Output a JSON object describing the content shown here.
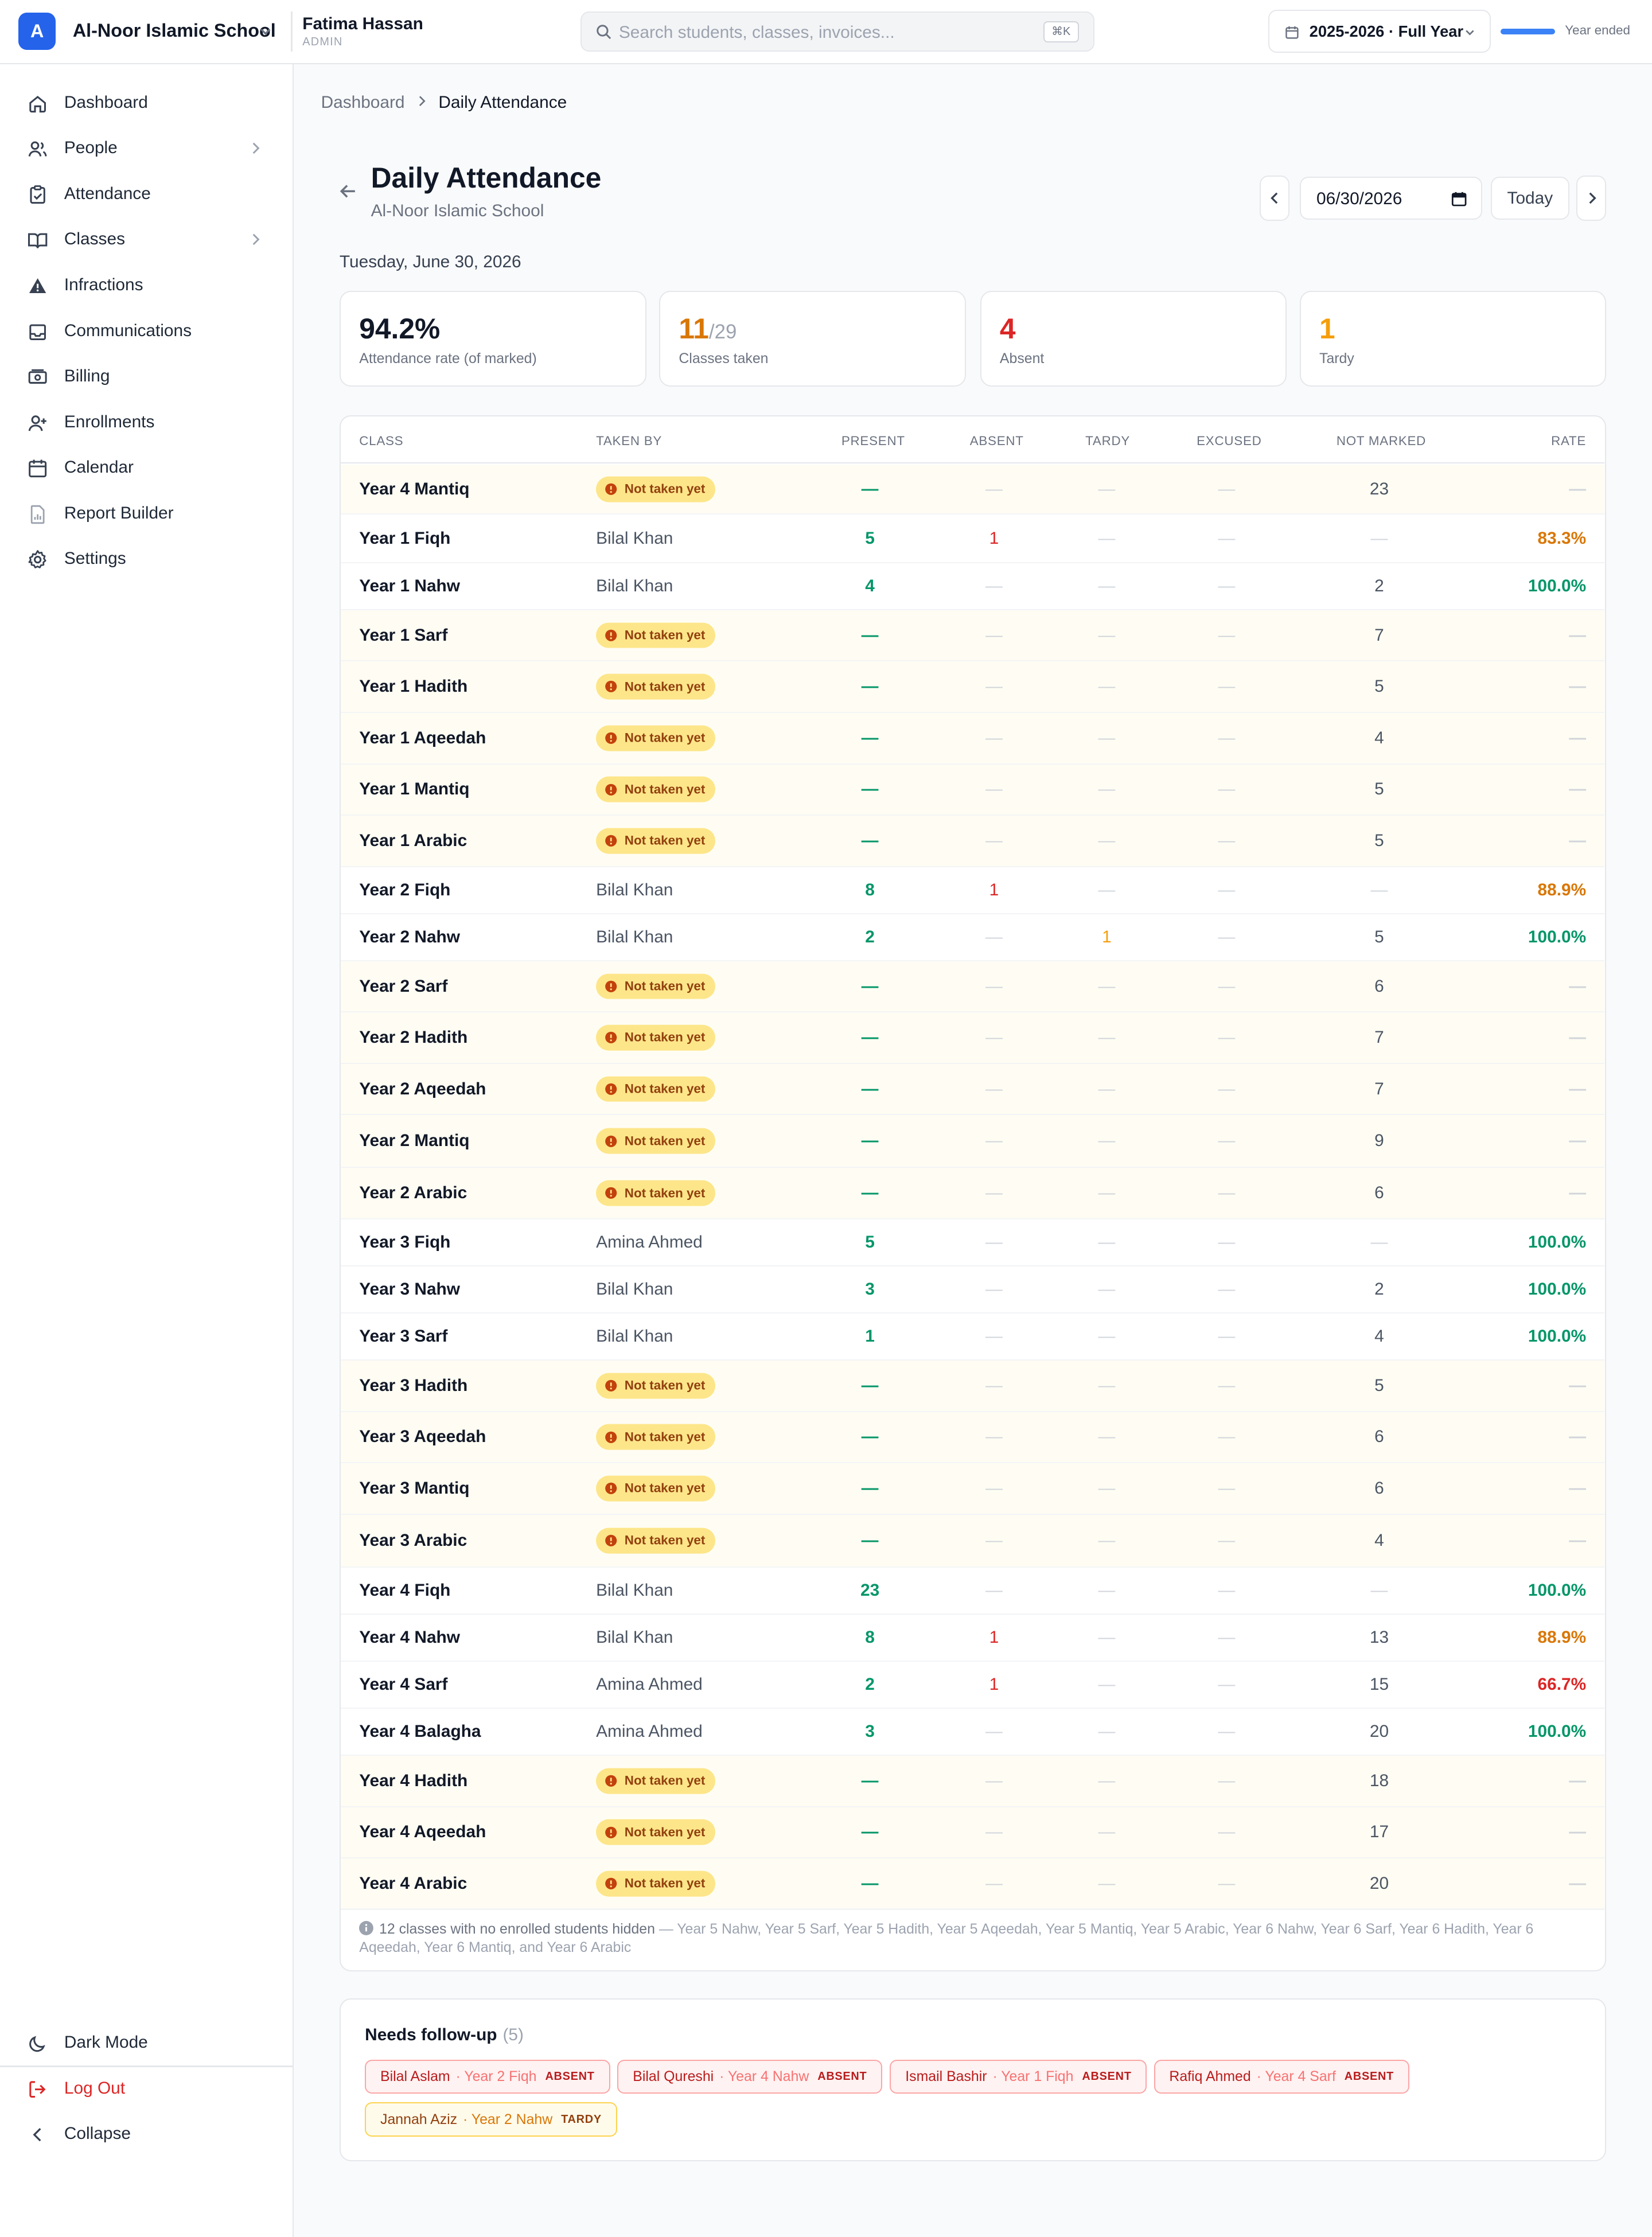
{
  "app": {
    "logo_letter": "A",
    "school_name": "Al-Noor Islamic School",
    "user_name": "Fatima Hassan",
    "user_role": "ADMIN",
    "search_placeholder": "Search students, classes, invoices...",
    "search_shortcut": "⌘K",
    "year_label": "2025-2026 · Full Year",
    "year_status": "Year ended",
    "year_progress": 1.0,
    "accent_color": "#2563eb"
  },
  "sidebar": {
    "items": [
      {
        "label": "Dashboard",
        "icon": "home-icon"
      },
      {
        "label": "People",
        "icon": "users-icon",
        "has_children": true
      },
      {
        "label": "Attendance",
        "icon": "clipboard-check-icon"
      },
      {
        "label": "Classes",
        "icon": "book-open-icon",
        "has_children": true
      },
      {
        "label": "Infractions",
        "icon": "alert-triangle-icon"
      },
      {
        "label": "Communications",
        "icon": "inbox-icon"
      },
      {
        "label": "Billing",
        "icon": "banknote-icon"
      },
      {
        "label": "Enrollments",
        "icon": "user-plus-icon"
      },
      {
        "label": "Calendar",
        "icon": "calendar-icon"
      },
      {
        "label": "Report Builder",
        "icon": "file-chart-icon"
      },
      {
        "label": "Settings",
        "icon": "gear-icon"
      }
    ],
    "bottom": {
      "dark_mode": "Dark Mode",
      "logout": "Log Out",
      "collapse": "Collapse"
    }
  },
  "breadcrumb": {
    "parent": "Dashboard",
    "current": "Daily Attendance"
  },
  "page": {
    "title": "Daily Attendance",
    "subtitle": "Al-Noor Islamic School",
    "date_value": "06/30/2026",
    "today_label": "Today",
    "long_date": "Tuesday, June 30, 2026"
  },
  "stats": {
    "rate": {
      "value": "94.2%",
      "label": "Attendance rate (of marked)",
      "color": "#111827"
    },
    "classes": {
      "value": "11",
      "denominator": "/29",
      "label": "Classes taken",
      "color": "#d97706"
    },
    "absent": {
      "value": "4",
      "label": "Absent",
      "color": "#dc2626"
    },
    "tardy": {
      "value": "1",
      "label": "Tardy",
      "color": "#f59e0b"
    }
  },
  "table": {
    "headers": {
      "class": "CLASS",
      "taken_by": "TAKEN BY",
      "present": "PRESENT",
      "absent": "ABSENT",
      "tardy": "TARDY",
      "excused": "EXCUSED",
      "not_marked": "NOT MARKED",
      "rate": "RATE"
    },
    "not_taken_label": "Not taken yet",
    "dash": "—",
    "rows": [
      {
        "class": "Year 4 Mantiq",
        "taken_by": null,
        "present": "—",
        "absent": "—",
        "tardy": "—",
        "excused": "—",
        "not_marked": "23",
        "rate": "—"
      },
      {
        "class": "Year 1 Fiqh",
        "taken_by": "Bilal Khan",
        "present": "5",
        "absent": "1",
        "tardy": "—",
        "excused": "—",
        "not_marked": "—",
        "rate": "83.3%"
      },
      {
        "class": "Year 1 Nahw",
        "taken_by": "Bilal Khan",
        "present": "4",
        "absent": "—",
        "tardy": "—",
        "excused": "—",
        "not_marked": "2",
        "rate": "100.0%"
      },
      {
        "class": "Year 1 Sarf",
        "taken_by": null,
        "present": "—",
        "absent": "—",
        "tardy": "—",
        "excused": "—",
        "not_marked": "7",
        "rate": "—"
      },
      {
        "class": "Year 1 Hadith",
        "taken_by": null,
        "present": "—",
        "absent": "—",
        "tardy": "—",
        "excused": "—",
        "not_marked": "5",
        "rate": "—"
      },
      {
        "class": "Year 1 Aqeedah",
        "taken_by": null,
        "present": "—",
        "absent": "—",
        "tardy": "—",
        "excused": "—",
        "not_marked": "4",
        "rate": "—"
      },
      {
        "class": "Year 1 Mantiq",
        "taken_by": null,
        "present": "—",
        "absent": "—",
        "tardy": "—",
        "excused": "—",
        "not_marked": "5",
        "rate": "—"
      },
      {
        "class": "Year 1 Arabic",
        "taken_by": null,
        "present": "—",
        "absent": "—",
        "tardy": "—",
        "excused": "—",
        "not_marked": "5",
        "rate": "—"
      },
      {
        "class": "Year 2 Fiqh",
        "taken_by": "Bilal Khan",
        "present": "8",
        "absent": "1",
        "tardy": "—",
        "excused": "—",
        "not_marked": "—",
        "rate": "88.9%"
      },
      {
        "class": "Year 2 Nahw",
        "taken_by": "Bilal Khan",
        "present": "2",
        "absent": "—",
        "tardy": "1",
        "excused": "—",
        "not_marked": "5",
        "rate": "100.0%"
      },
      {
        "class": "Year 2 Sarf",
        "taken_by": null,
        "present": "—",
        "absent": "—",
        "tardy": "—",
        "excused": "—",
        "not_marked": "6",
        "rate": "—"
      },
      {
        "class": "Year 2 Hadith",
        "taken_by": null,
        "present": "—",
        "absent": "—",
        "tardy": "—",
        "excused": "—",
        "not_marked": "7",
        "rate": "—"
      },
      {
        "class": "Year 2 Aqeedah",
        "taken_by": null,
        "present": "—",
        "absent": "—",
        "tardy": "—",
        "excused": "—",
        "not_marked": "7",
        "rate": "—"
      },
      {
        "class": "Year 2 Mantiq",
        "taken_by": null,
        "present": "—",
        "absent": "—",
        "tardy": "—",
        "excused": "—",
        "not_marked": "9",
        "rate": "—"
      },
      {
        "class": "Year 2 Arabic",
        "taken_by": null,
        "present": "—",
        "absent": "—",
        "tardy": "—",
        "excused": "—",
        "not_marked": "6",
        "rate": "—"
      },
      {
        "class": "Year 3 Fiqh",
        "taken_by": "Amina Ahmed",
        "present": "5",
        "absent": "—",
        "tardy": "—",
        "excused": "—",
        "not_marked": "—",
        "rate": "100.0%"
      },
      {
        "class": "Year 3 Nahw",
        "taken_by": "Bilal Khan",
        "present": "3",
        "absent": "—",
        "tardy": "—",
        "excused": "—",
        "not_marked": "2",
        "rate": "100.0%"
      },
      {
        "class": "Year 3 Sarf",
        "taken_by": "Bilal Khan",
        "present": "1",
        "absent": "—",
        "tardy": "—",
        "excused": "—",
        "not_marked": "4",
        "rate": "100.0%"
      },
      {
        "class": "Year 3 Hadith",
        "taken_by": null,
        "present": "—",
        "absent": "—",
        "tardy": "—",
        "excused": "—",
        "not_marked": "5",
        "rate": "—"
      },
      {
        "class": "Year 3 Aqeedah",
        "taken_by": null,
        "present": "—",
        "absent": "—",
        "tardy": "—",
        "excused": "—",
        "not_marked": "6",
        "rate": "—"
      },
      {
        "class": "Year 3 Mantiq",
        "taken_by": null,
        "present": "—",
        "absent": "—",
        "tardy": "—",
        "excused": "—",
        "not_marked": "6",
        "rate": "—"
      },
      {
        "class": "Year 3 Arabic",
        "taken_by": null,
        "present": "—",
        "absent": "—",
        "tardy": "—",
        "excused": "—",
        "not_marked": "4",
        "rate": "—"
      },
      {
        "class": "Year 4 Fiqh",
        "taken_by": "Bilal Khan",
        "present": "23",
        "absent": "—",
        "tardy": "—",
        "excused": "—",
        "not_marked": "—",
        "rate": "100.0%"
      },
      {
        "class": "Year 4 Nahw",
        "taken_by": "Bilal Khan",
        "present": "8",
        "absent": "1",
        "tardy": "—",
        "excused": "—",
        "not_marked": "13",
        "rate": "88.9%"
      },
      {
        "class": "Year 4 Sarf",
        "taken_by": "Amina Ahmed",
        "present": "2",
        "absent": "1",
        "tardy": "—",
        "excused": "—",
        "not_marked": "15",
        "rate": "66.7%"
      },
      {
        "class": "Year 4 Balagha",
        "taken_by": "Amina Ahmed",
        "present": "3",
        "absent": "—",
        "tardy": "—",
        "excused": "—",
        "not_marked": "20",
        "rate": "100.0%"
      },
      {
        "class": "Year 4 Hadith",
        "taken_by": null,
        "present": "—",
        "absent": "—",
        "tardy": "—",
        "excused": "—",
        "not_marked": "18",
        "rate": "—"
      },
      {
        "class": "Year 4 Aqeedah",
        "taken_by": null,
        "present": "—",
        "absent": "—",
        "tardy": "—",
        "excused": "—",
        "not_marked": "17",
        "rate": "—"
      },
      {
        "class": "Year 4 Arabic",
        "taken_by": null,
        "present": "—",
        "absent": "—",
        "tardy": "—",
        "excused": "—",
        "not_marked": "20",
        "rate": "—"
      }
    ],
    "note_lead": "12 classes with no enrolled students hidden",
    "note_list": " — Year 5 Nahw, Year 5 Sarf, Year 5 Hadith, Year 5 Aqeedah, Year 5 Mantiq, Year 5 Arabic, Year 6 Nahw, Year 6 Sarf, Year 6 Hadith, Year 6 Aqeedah, Year 6 Mantiq, and Year 6 Arabic"
  },
  "followup": {
    "title": "Needs follow-up",
    "count": "(5)",
    "items": [
      {
        "name": "Bilal Aslam",
        "class": "· Year 2 Fiqh",
        "status": "ABSENT",
        "kind": "absent"
      },
      {
        "name": "Bilal Qureshi",
        "class": "· Year 4 Nahw",
        "status": "ABSENT",
        "kind": "absent"
      },
      {
        "name": "Ismail Bashir",
        "class": "· Year 1 Fiqh",
        "status": "ABSENT",
        "kind": "absent"
      },
      {
        "name": "Rafiq Ahmed",
        "class": "· Year 4 Sarf",
        "status": "ABSENT",
        "kind": "absent"
      },
      {
        "name": "Jannah Aziz",
        "class": "· Year 2 Nahw",
        "status": "TARDY",
        "kind": "tardy"
      }
    ]
  }
}
